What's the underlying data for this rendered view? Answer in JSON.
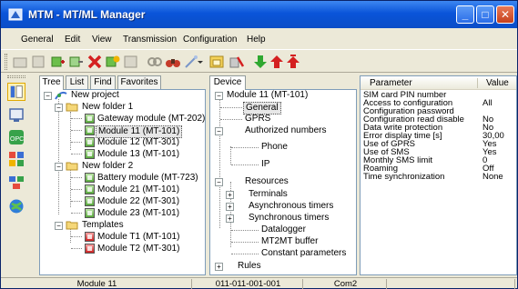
{
  "window": {
    "title": "MTM - MT/ML Manager"
  },
  "menu": [
    "General",
    "Edit",
    "View",
    "Transmission",
    "Configuration",
    "Help"
  ],
  "left_tabs": [
    {
      "label": "Tree"
    },
    {
      "label": "List"
    },
    {
      "label": "Find"
    },
    {
      "label": "Favorites"
    }
  ],
  "project_tree": {
    "root": "New project",
    "folders": [
      {
        "name": "New folder 1",
        "modules": [
          "Gateway module (MT-202)",
          "Module 11 (MT-101)",
          "Module 12 (MT-301)",
          "Module 13 (MT-101)"
        ]
      },
      {
        "name": "New folder 2",
        "modules": [
          "Battery module (MT-723)",
          "Module 21 (MT-101)",
          "Module 22 (MT-301)",
          "Module 23 (MT-101)"
        ]
      },
      {
        "name": "Templates",
        "modules": [
          "Module T1 (MT-101)",
          "Module T2 (MT-301)"
        ]
      }
    ],
    "selected": "Module 11 (MT-101)"
  },
  "device_tab": {
    "label": "Device"
  },
  "device_tree": {
    "root": "Module 11 (MT-101)",
    "items": {
      "general": "General",
      "gprs": "GPRS",
      "authorized": "Authorized numbers",
      "phone": "Phone",
      "ip": "IP",
      "resources": "Resources",
      "terminals": "Terminals",
      "async_timers": "Asynchronous timers",
      "sync_timers": "Synchronous timers",
      "datalogger": "Datalogger",
      "mt2mt": "MT2MT buffer",
      "constants": "Constant parameters",
      "rules": "Rules"
    },
    "selected": "General"
  },
  "grid": {
    "headers": {
      "parameter": "Parameter",
      "value": "Value"
    },
    "rows": [
      {
        "parameter": "SIM card PIN number",
        "value": ""
      },
      {
        "parameter": "Access to configuration",
        "value": "All"
      },
      {
        "parameter": "Configuration password",
        "value": ""
      },
      {
        "parameter": "Configuration read disable",
        "value": "No"
      },
      {
        "parameter": "Data write protection",
        "value": "No"
      },
      {
        "parameter": "Error display time [s]",
        "value": "30,00"
      },
      {
        "parameter": "Use of GPRS",
        "value": "Yes"
      },
      {
        "parameter": "Use of SMS",
        "value": "Yes"
      },
      {
        "parameter": "Monthly SMS limit",
        "value": "0"
      },
      {
        "parameter": "Roaming",
        "value": "Off"
      },
      {
        "parameter": "Time synchronization",
        "value": "None"
      }
    ]
  },
  "status": {
    "module": "Module 11",
    "address": "011-011-001-001",
    "port": "Com2"
  },
  "colors": {
    "titlebar": "#0a54d9",
    "selection": "#e7e7e7",
    "panel_border": "#7f9db9"
  }
}
